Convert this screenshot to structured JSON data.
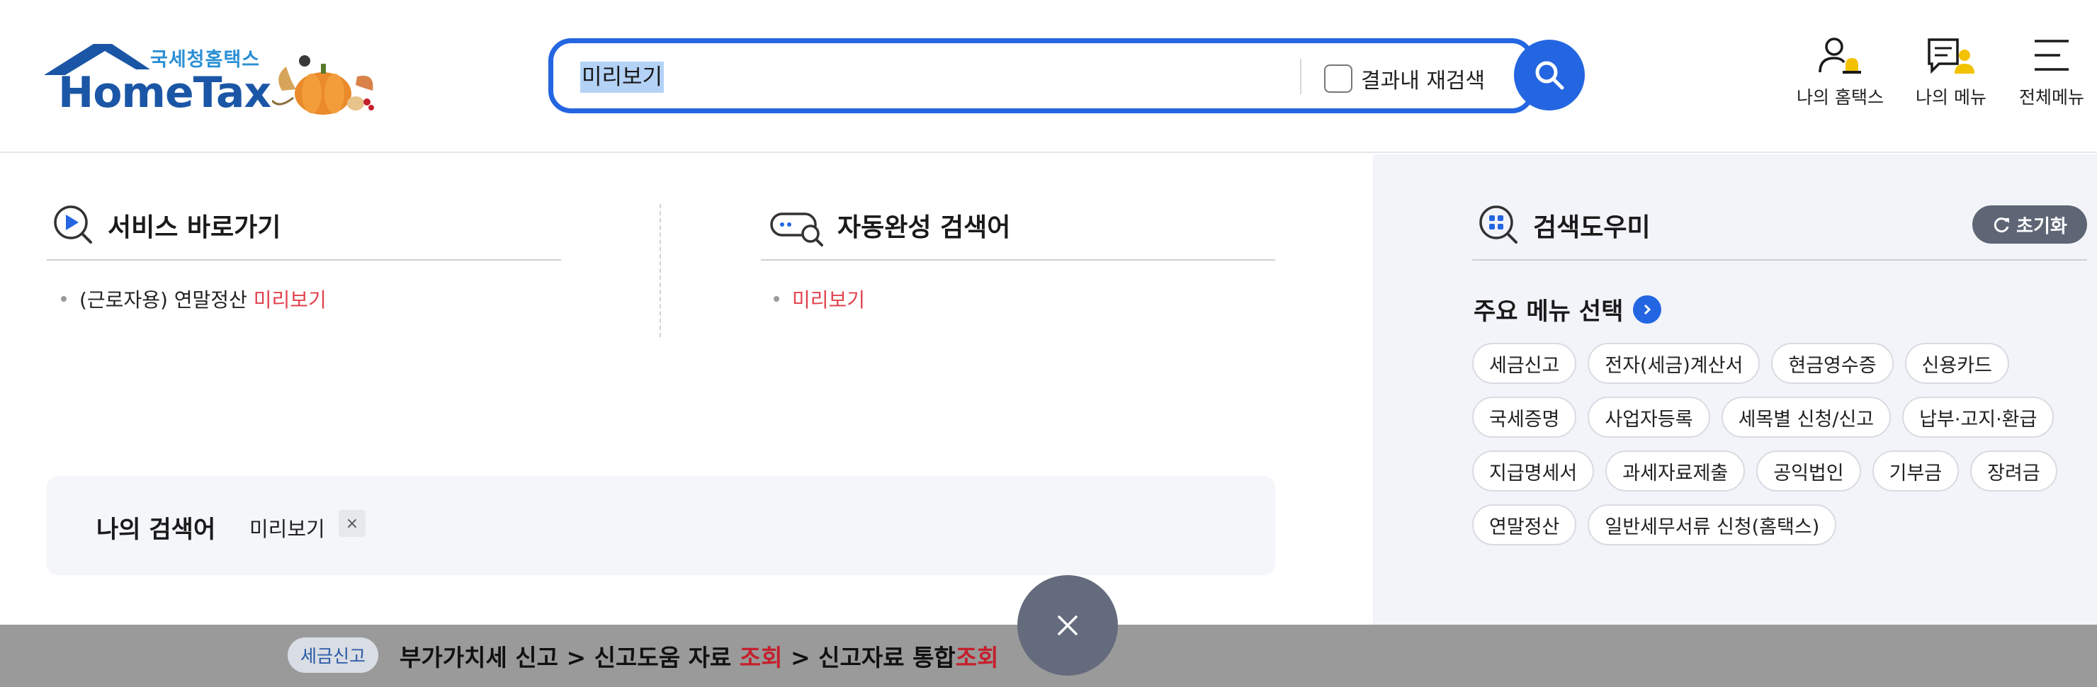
{
  "header": {
    "logo_sub": "국세청홈택스",
    "logo_main": "HomeTax",
    "search": {
      "value": "미리보기",
      "recheck_label": "결과내 재검색"
    },
    "util": [
      {
        "label": "나의 홈택스",
        "icon": "user-bell-icon"
      },
      {
        "label": "나의 메뉴",
        "icon": "menu-doc-user-icon"
      },
      {
        "label": "전체메뉴",
        "icon": "hamburger-icon"
      }
    ]
  },
  "service_shortcut": {
    "title": "서비스 바로가기",
    "items": [
      {
        "prefix": "(근로자용) 연말정산 ",
        "highlight": "미리보기"
      }
    ]
  },
  "autocomplete": {
    "title": "자동완성 검색어",
    "items": [
      {
        "highlight": "미리보기"
      }
    ]
  },
  "recent_search": {
    "title": "나의 검색어",
    "keyword": "미리보기",
    "remove_label": "×"
  },
  "search_helper": {
    "title": "검색도우미",
    "reset_label": "초기화",
    "main_menu_title": "주요 메뉴 선택",
    "chips": [
      "세금신고",
      "전자(세금)계산서",
      "현금영수증",
      "신용카드",
      "국세증명",
      "사업자등록",
      "세목별 신청/신고",
      "납부·고지·환급",
      "지급명세서",
      "과세자료제출",
      "공익법인",
      "기부금",
      "장려금",
      "연말정산",
      "일반세무서류 신청(홈택스)"
    ]
  },
  "bottom_bar": {
    "badge": "세금신고",
    "path_part1": "부가가치세 신고 > 신고도움 자료 ",
    "path_red1": "조회",
    "path_part2": " > 신고자료 통합",
    "path_red2": "조회"
  },
  "colors": {
    "accent": "#2466e1",
    "highlight": "#e2414c",
    "panel_bg": "#f2f4f9",
    "bottom_bar": "#9a9a9a"
  }
}
